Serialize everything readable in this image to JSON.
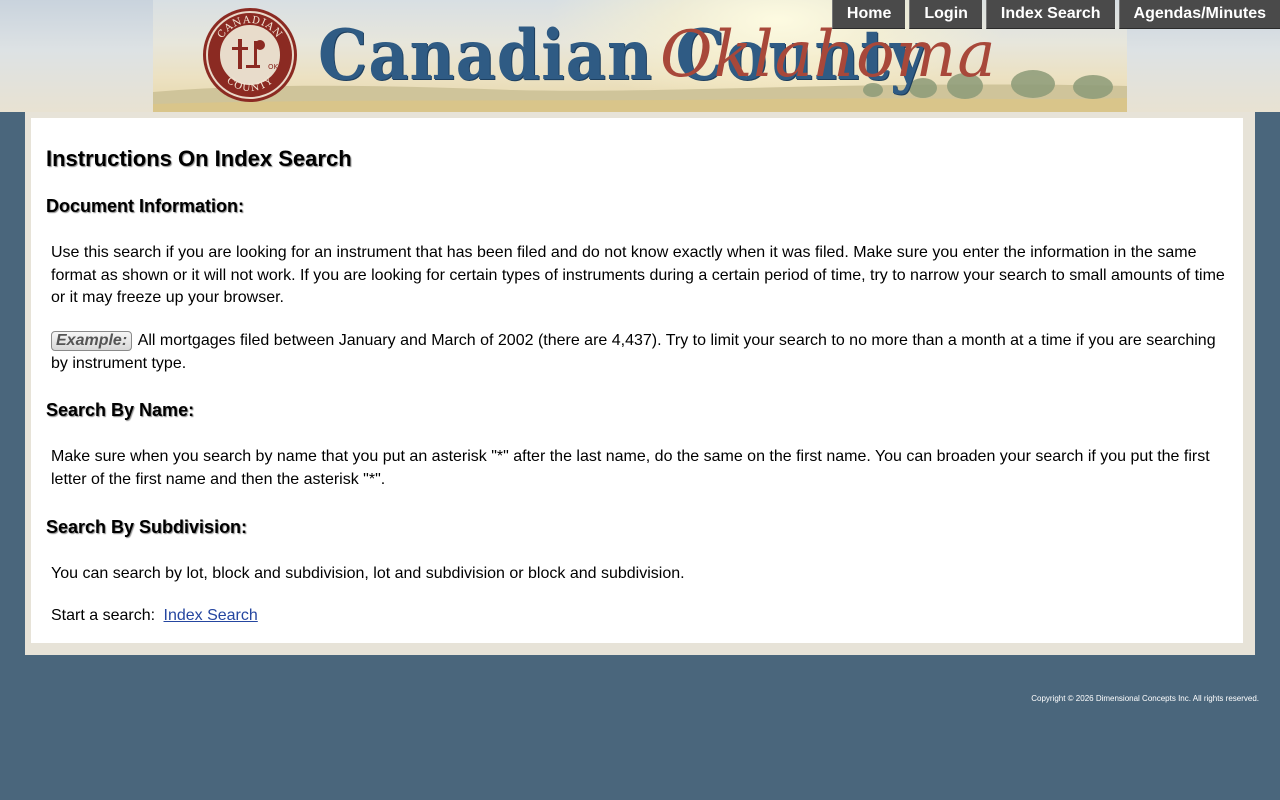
{
  "header": {
    "logo_text": "Canadian County",
    "logo_script": "Oklahoma",
    "seal_text": "CANADIAN COUNTY OK"
  },
  "nav": {
    "items": [
      "Home",
      "Login",
      "Index Search",
      "Agendas/Minutes"
    ]
  },
  "main": {
    "title": "Instructions On Index Search",
    "sections": [
      {
        "heading": "Document Information:",
        "paragraph": "Use this search if you are looking for an instrument that has been filed and do not know exactly when it was filed. Make sure you enter the information in the same format as shown or it will not work. If you are looking for certain types of instruments during a certain period of time, try to narrow your search to small amounts of time or it may freeze up your browser.",
        "example_label": "Example:",
        "example_text": "All mortgages filed between January and March of 2002 (there are 4,437). Try to limit your search to no more than a month at a time if you are searching by instrument type."
      },
      {
        "heading": "Search By Name:",
        "paragraph": "Make sure when you search by name that you put an asterisk \"*\" after the last name, do the same on the first name. You can broaden your search if you put the first letter of the first name and then the asterisk \"*\"."
      },
      {
        "heading": "Search By Subdivision:",
        "paragraph": "You can search by lot, block and subdivision, lot and subdivision or block and subdivision."
      }
    ],
    "start_label": "Start a search:",
    "start_link": "Index Search"
  },
  "footer": {
    "copyright": "Copyright © 2026 Dimensional Concepts Inc. All rights reserved."
  },
  "colors": {
    "background": "#4a667c",
    "nav_bg": "#4a4a4a",
    "title_blue": "#2f5b84",
    "script_red": "#a8483a",
    "link": "#2546a0"
  }
}
